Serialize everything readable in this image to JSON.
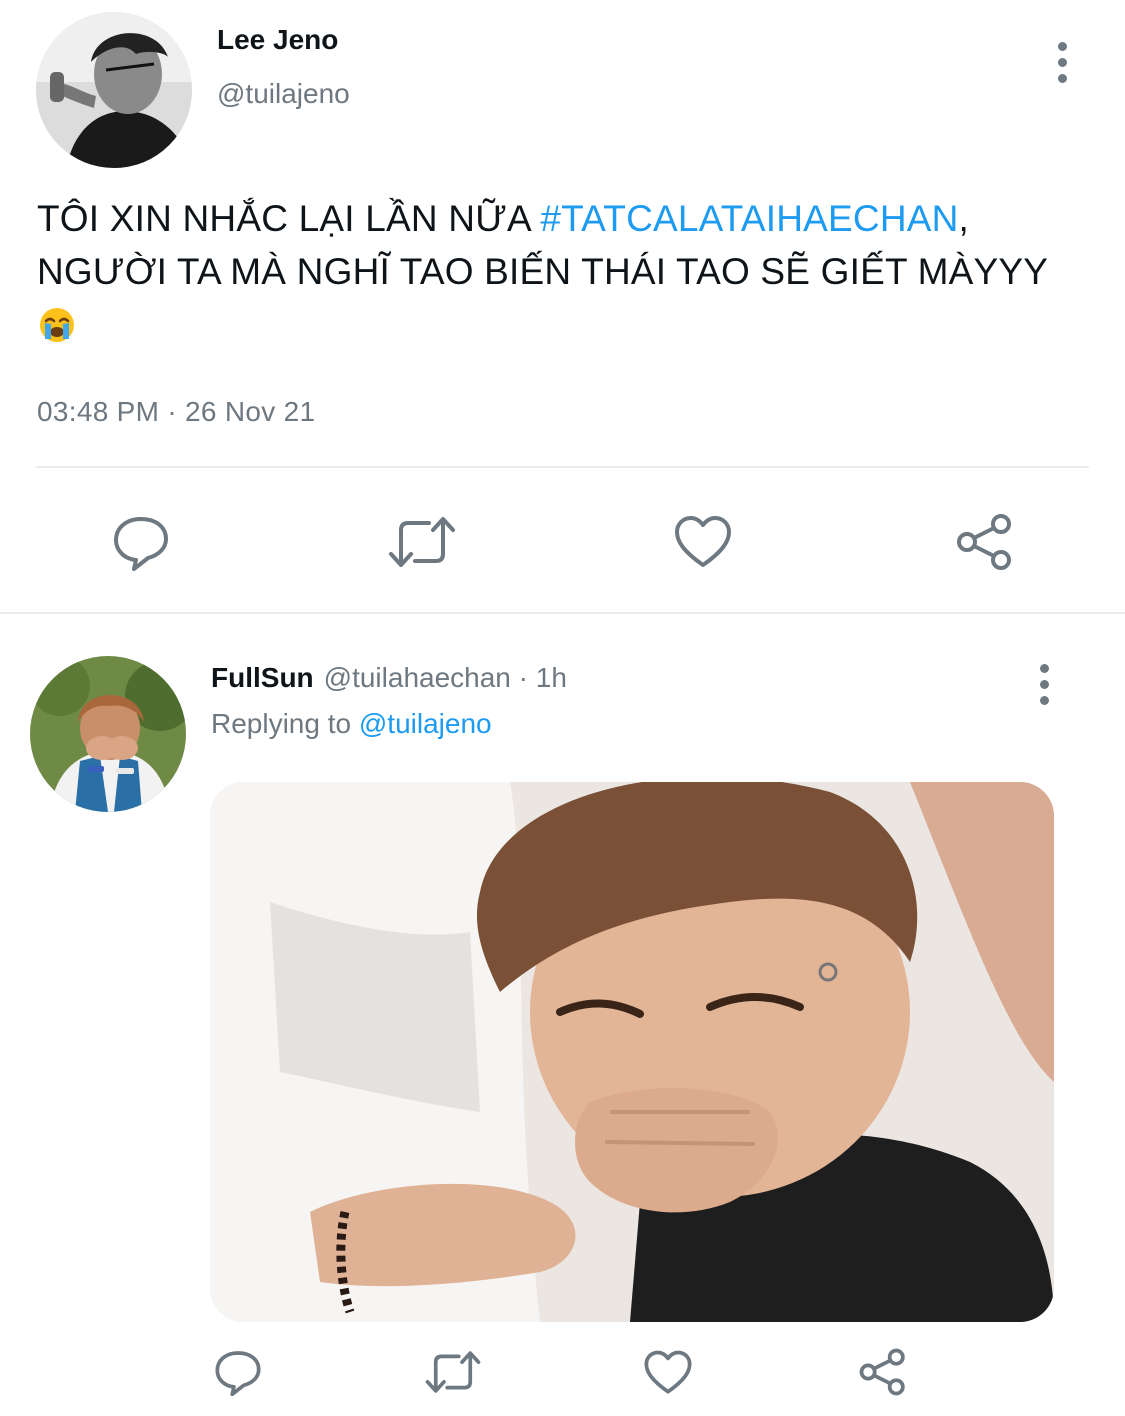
{
  "tweet": {
    "author": {
      "display_name": "Lee Jeno",
      "handle": "@tuilajeno",
      "avatar_icon": "profile-photo-bw"
    },
    "text_part1": "TÔI XIN NHẮC LẠI LẦN NỮA ",
    "hashtag": "#TATCALATAIHAECHAN",
    "text_part2": ", NGƯỜI TA MÀ NGHĨ TAO BIẾN THÁI TAO SẼ GIẾT MÀYYY",
    "emoji_icon": "loudly-crying-face-emoji",
    "timestamp": "03:48 PM · 26 Nov 21",
    "actions": [
      "reply-icon",
      "retweet-icon",
      "like-icon",
      "share-icon"
    ]
  },
  "reply": {
    "author": {
      "display_name": "FullSun",
      "handle": "@tuilahaechan",
      "avatar_icon": "profile-photo-color"
    },
    "separator": " · ",
    "time_ago": "1h",
    "replying_prefix": "Replying to ",
    "replying_to": "@tuilajeno",
    "media_icon": "reaction-photo",
    "actions": [
      "reply-icon",
      "retweet-icon",
      "like-icon",
      "share-icon"
    ]
  },
  "colors": {
    "link": "#1d9bf0",
    "secondary_text": "#6e7881",
    "primary_text": "#0f1419",
    "divider": "#e6ecf0"
  }
}
